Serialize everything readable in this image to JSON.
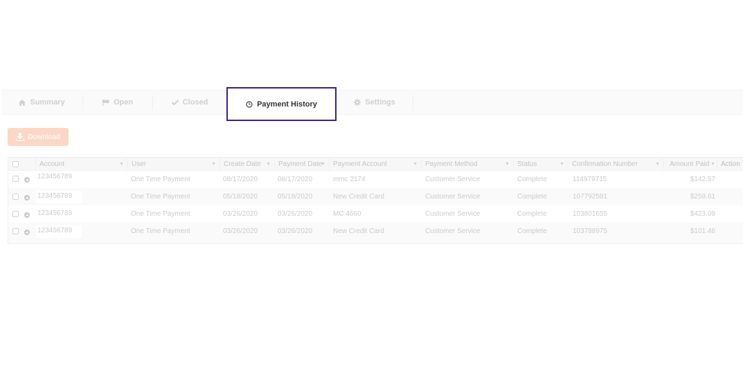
{
  "tabs": [
    {
      "label": "Summary",
      "icon": "home-icon",
      "active": false
    },
    {
      "label": "Open",
      "icon": "flag-icon",
      "active": false
    },
    {
      "label": "Closed",
      "icon": "check-icon",
      "active": false
    },
    {
      "label": "Payment History",
      "icon": "clock-icon",
      "active": true
    },
    {
      "label": "Settings",
      "icon": "gear-icon",
      "active": false
    }
  ],
  "toolbar": {
    "download_label": "Download"
  },
  "colors": {
    "active_tab_border": "#3c1f82",
    "download_bg": "#fbd8c6"
  },
  "table": {
    "columns": [
      "Account",
      "User",
      "Create Date",
      "Payment Date",
      "Payment Account",
      "Payment Method",
      "Status",
      "Confirmation Number",
      "Amount Paid",
      "Action"
    ],
    "rows": [
      {
        "account": "123456789",
        "user": "One Time Payment",
        "create_date": "08/17/2020",
        "payment_date": "08/17/2020",
        "payment_account": "mmc 2174",
        "payment_method": "Customer Service",
        "status": "Complete",
        "confirmation": "114979715",
        "amount": "$142.57"
      },
      {
        "account": "123456789",
        "user": "One Time Payment",
        "create_date": "05/18/2020",
        "payment_date": "05/18/2020",
        "payment_account": "New Credit Card",
        "payment_method": "Customer Service",
        "status": "Complete",
        "confirmation": "107792591",
        "amount": "$259.61"
      },
      {
        "account": "123456789",
        "user": "One Time Payment",
        "create_date": "03/26/2020",
        "payment_date": "03/26/2020",
        "payment_account": "MC 4660",
        "payment_method": "Customer Service",
        "status": "Complete",
        "confirmation": "103801655",
        "amount": "$423.09"
      },
      {
        "account": "123456789",
        "user": "One Time Payment",
        "create_date": "03/26/2020",
        "payment_date": "03/26/2020",
        "payment_account": "New Credit Card",
        "payment_method": "Customer Service",
        "status": "Complete",
        "confirmation": "103788975",
        "amount": "$101.46"
      }
    ]
  }
}
